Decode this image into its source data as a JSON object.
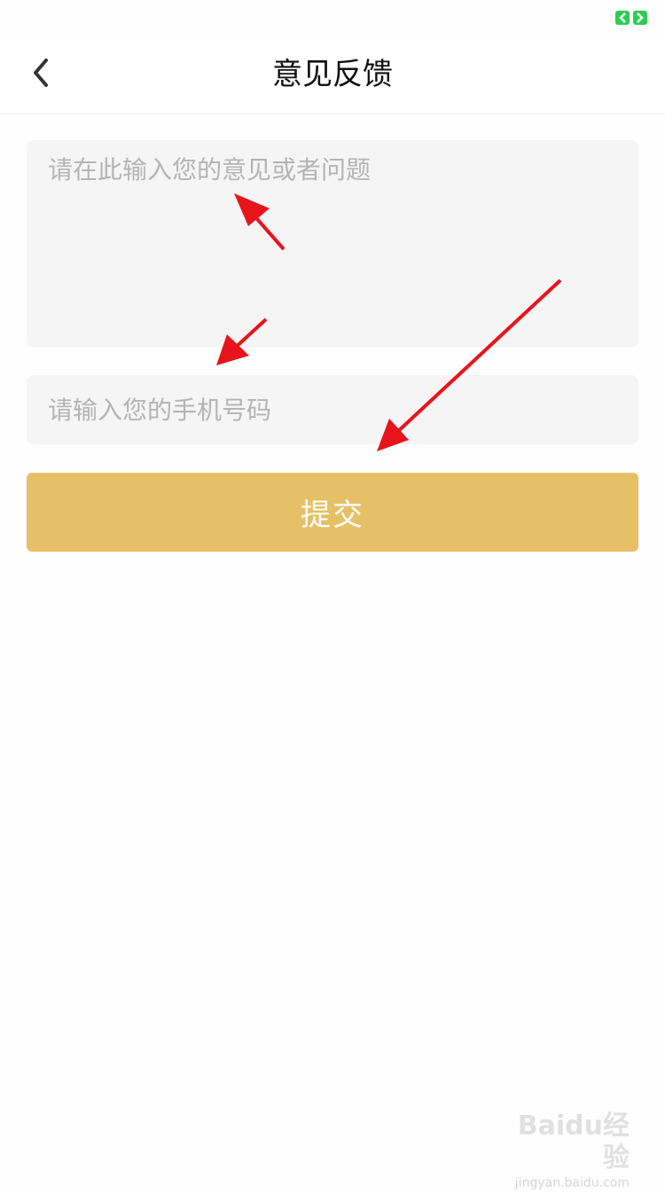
{
  "header": {
    "title": "意见反馈",
    "back_icon": "chevron-left-icon"
  },
  "form": {
    "feedback_placeholder": "请在此输入您的意见或者问题",
    "feedback_value": "",
    "phone_placeholder": "请输入您的手机号码",
    "phone_value": "",
    "submit_label": "提交"
  },
  "watermark": {
    "logo_text": "Baidu经验",
    "url_text": "jingyan.baidu.com"
  },
  "annotations": {
    "arrow_icon": "red-arrow-icon",
    "arrow_color": "#e8141b"
  },
  "colors": {
    "accent": "#e5c066",
    "status_indicator": "#2ecc55",
    "input_background": "#f5f5f5"
  }
}
